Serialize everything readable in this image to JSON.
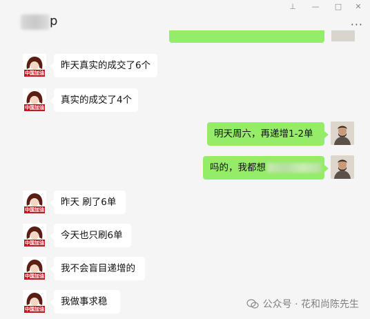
{
  "window": {
    "title_visible": "p",
    "controls": {
      "pin": "⊥",
      "minimize": "—",
      "maximize": "□",
      "close": "✕"
    },
    "more": "···"
  },
  "messages": [
    {
      "side": "left",
      "text": "昨天真实的成交了6个"
    },
    {
      "side": "left",
      "text": "真实的成交了4个"
    },
    {
      "side": "right",
      "text": "明天周六，再递增1-2单"
    },
    {
      "side": "right",
      "text": "吗的，我都想"
    },
    {
      "side": "left",
      "text": "昨天 刷了6单"
    },
    {
      "side": "left",
      "text": "今天也只刷6单"
    },
    {
      "side": "left",
      "text": "我不会盲目递增的"
    },
    {
      "side": "left",
      "text": "我做事求稳"
    }
  ],
  "avatar_caption": "中国加油",
  "watermark": {
    "text": "公众号 · 花和尚陈先生"
  },
  "colors": {
    "background": "#f5f5f5",
    "bubble_left": "#ffffff",
    "bubble_right": "#95ec69",
    "avatar_caption_bg": "#c0171f"
  }
}
